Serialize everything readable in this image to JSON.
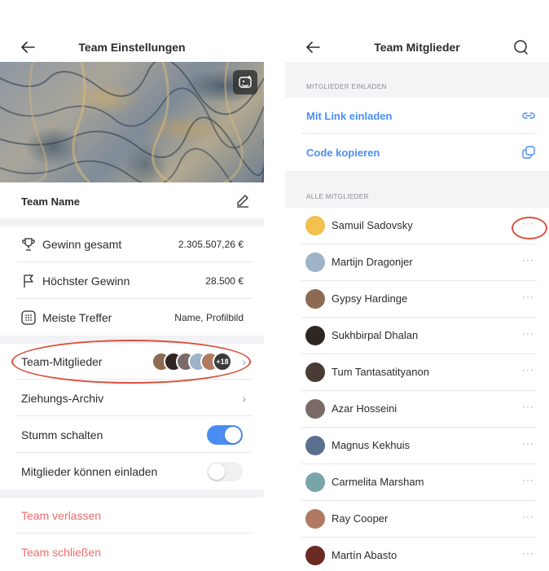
{
  "left_screen": {
    "title": "Team Einstellungen",
    "back_icon": "arrow-left-icon",
    "photo_edit_icon": "image-edit-icon",
    "team_name_label": "Team Name",
    "edit_icon": "pencil-icon",
    "stats": [
      {
        "icon": "trophy-icon",
        "label": "Gewinn gesamt",
        "value": "2.305.507,26 €"
      },
      {
        "icon": "flag-icon",
        "label": "Höchster Gewinn",
        "value": "28.500 €"
      },
      {
        "icon": "grid-icon",
        "label": "Meiste Treffer",
        "value": "Name, Profilbild"
      }
    ],
    "members_label": "Team-Mitglieder",
    "members_more_count": "+18",
    "archive_label": "Ziehungs-Archiv",
    "mute_label": "Stumm schalten",
    "mute_on": true,
    "invite_label": "Mitglieder können einladen",
    "invite_on": false,
    "leave_label": "Team verlassen",
    "close_label": "Team schließen"
  },
  "right_screen": {
    "title": "Team Mitglieder",
    "back_icon": "arrow-left-icon",
    "search_icon": "search-icon",
    "invite_section": "MITGLIEDER EINLADEN",
    "invite_link_label": "Mit Link einladen",
    "invite_link_icon": "link-icon",
    "copy_code_label": "Code kopieren",
    "copy_code_icon": "copy-icon",
    "all_members_section": "ALLE MITGLIEDER",
    "members": [
      {
        "name": "Samuil Sadovsky",
        "color": "#f2c14e"
      },
      {
        "name": "Martijn Dragonjer",
        "color": "#9fb3c8"
      },
      {
        "name": "Gypsy Hardinge",
        "color": "#8c6b52"
      },
      {
        "name": "Sukhbirpal Dhalan",
        "color": "#2f2622"
      },
      {
        "name": "Tum Tantasatityanon",
        "color": "#4a3b36"
      },
      {
        "name": "Azar Hosseini",
        "color": "#7a6a68"
      },
      {
        "name": "Magnus Kekhuis",
        "color": "#5a6f8e"
      },
      {
        "name": "Carmelita Marsham",
        "color": "#7aa5a8"
      },
      {
        "name": "Ray Cooper",
        "color": "#b07a62"
      },
      {
        "name": "Martín Abasto",
        "color": "#6b2a22"
      }
    ],
    "more_icon": "more-horizontal-icon"
  },
  "colors": {
    "accent": "#4b8ef3",
    "danger": "#ef6a6a",
    "annotation": "#d9503c"
  }
}
